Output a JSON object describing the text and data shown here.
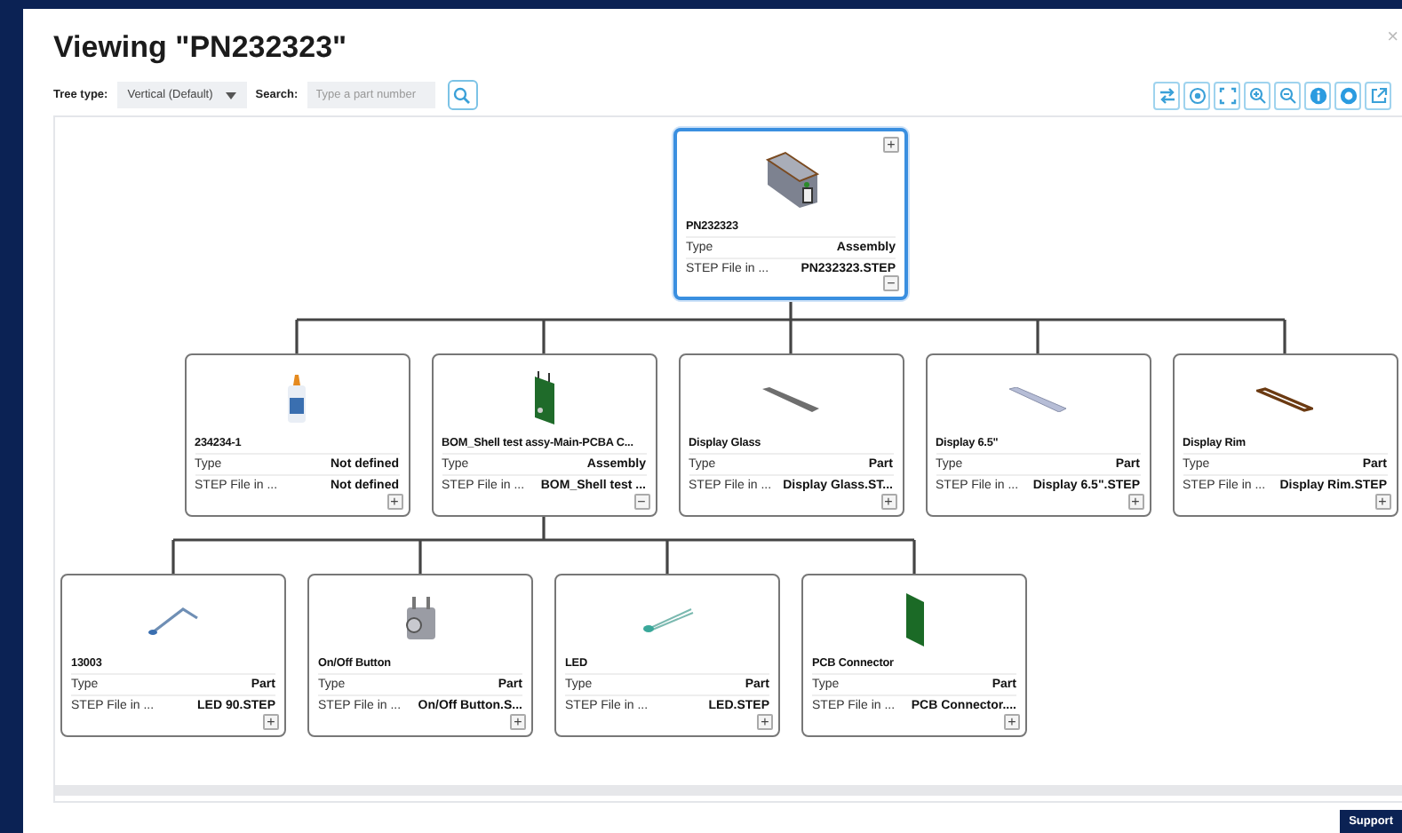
{
  "dialog": {
    "title": "Viewing \"PN232323\"",
    "close": "×"
  },
  "toolbar": {
    "tree_type_label": "Tree type:",
    "tree_type_value": "Vertical (Default)",
    "search_label": "Search:",
    "search_placeholder": "Type a part number"
  },
  "view_buttons": [
    {
      "kind": "swap"
    },
    {
      "kind": "target"
    },
    {
      "kind": "fit"
    },
    {
      "kind": "zoom-in"
    },
    {
      "kind": "zoom-out"
    },
    {
      "kind": "info"
    },
    {
      "kind": "ring"
    },
    {
      "kind": "external"
    }
  ],
  "tree": {
    "name": "PN232323",
    "kind": "enclosure",
    "selected": true,
    "top_toggle": "+",
    "toggle": "−",
    "rows": [
      {
        "label": "Type",
        "value": "Assembly"
      },
      {
        "label": "STEP File in ...",
        "value": "PN232323.STEP"
      }
    ],
    "children": [
      {
        "name": "234234-1",
        "kind": "bottle",
        "selected": false,
        "toggle": "+",
        "rows": [
          {
            "label": "Type",
            "value": "Not defined"
          },
          {
            "label": "STEP File in ...",
            "value": "Not defined"
          }
        ]
      },
      {
        "name": "BOM_Shell test assy-Main-PCBA C...",
        "kind": "board",
        "selected": false,
        "toggle": "−",
        "rows": [
          {
            "label": "Type",
            "value": "Assembly"
          },
          {
            "label": "STEP File in ...",
            "value": "BOM_Shell test ..."
          }
        ],
        "children": [
          {
            "name": "13003",
            "kind": "bent-rod",
            "selected": false,
            "toggle": "+",
            "rows": [
              {
                "label": "Type",
                "value": "Part"
              },
              {
                "label": "STEP File in ...",
                "value": "LED 90.STEP"
              }
            ]
          },
          {
            "name": "On/Off Button",
            "kind": "switch",
            "selected": false,
            "toggle": "+",
            "rows": [
              {
                "label": "Type",
                "value": "Part"
              },
              {
                "label": "STEP File in ...",
                "value": "On/Off Button.S..."
              }
            ]
          },
          {
            "name": "LED",
            "kind": "led",
            "selected": false,
            "toggle": "+",
            "rows": [
              {
                "label": "Type",
                "value": "Part"
              },
              {
                "label": "STEP File in ...",
                "value": "LED.STEP"
              }
            ]
          },
          {
            "name": "PCB Connector",
            "kind": "connector-board",
            "selected": false,
            "toggle": "+",
            "rows": [
              {
                "label": "Type",
                "value": "Part"
              },
              {
                "label": "STEP File in ...",
                "value": "PCB Connector...."
              }
            ]
          }
        ]
      },
      {
        "name": "Display Glass",
        "kind": "glass",
        "selected": false,
        "toggle": "+",
        "rows": [
          {
            "label": "Type",
            "value": "Part"
          },
          {
            "label": "STEP File in ...",
            "value": "Display Glass.ST..."
          }
        ]
      },
      {
        "name": "Display 6.5\"",
        "kind": "display",
        "selected": false,
        "toggle": "+",
        "rows": [
          {
            "label": "Type",
            "value": "Part"
          },
          {
            "label": "STEP File in ...",
            "value": "Display 6.5\".STEP"
          }
        ]
      },
      {
        "name": "Display Rim",
        "kind": "rim",
        "selected": false,
        "toggle": "+",
        "rows": [
          {
            "label": "Type",
            "value": "Part"
          },
          {
            "label": "STEP File in ...",
            "value": "Display Rim.STEP"
          }
        ]
      }
    ]
  },
  "support_button": "Support"
}
